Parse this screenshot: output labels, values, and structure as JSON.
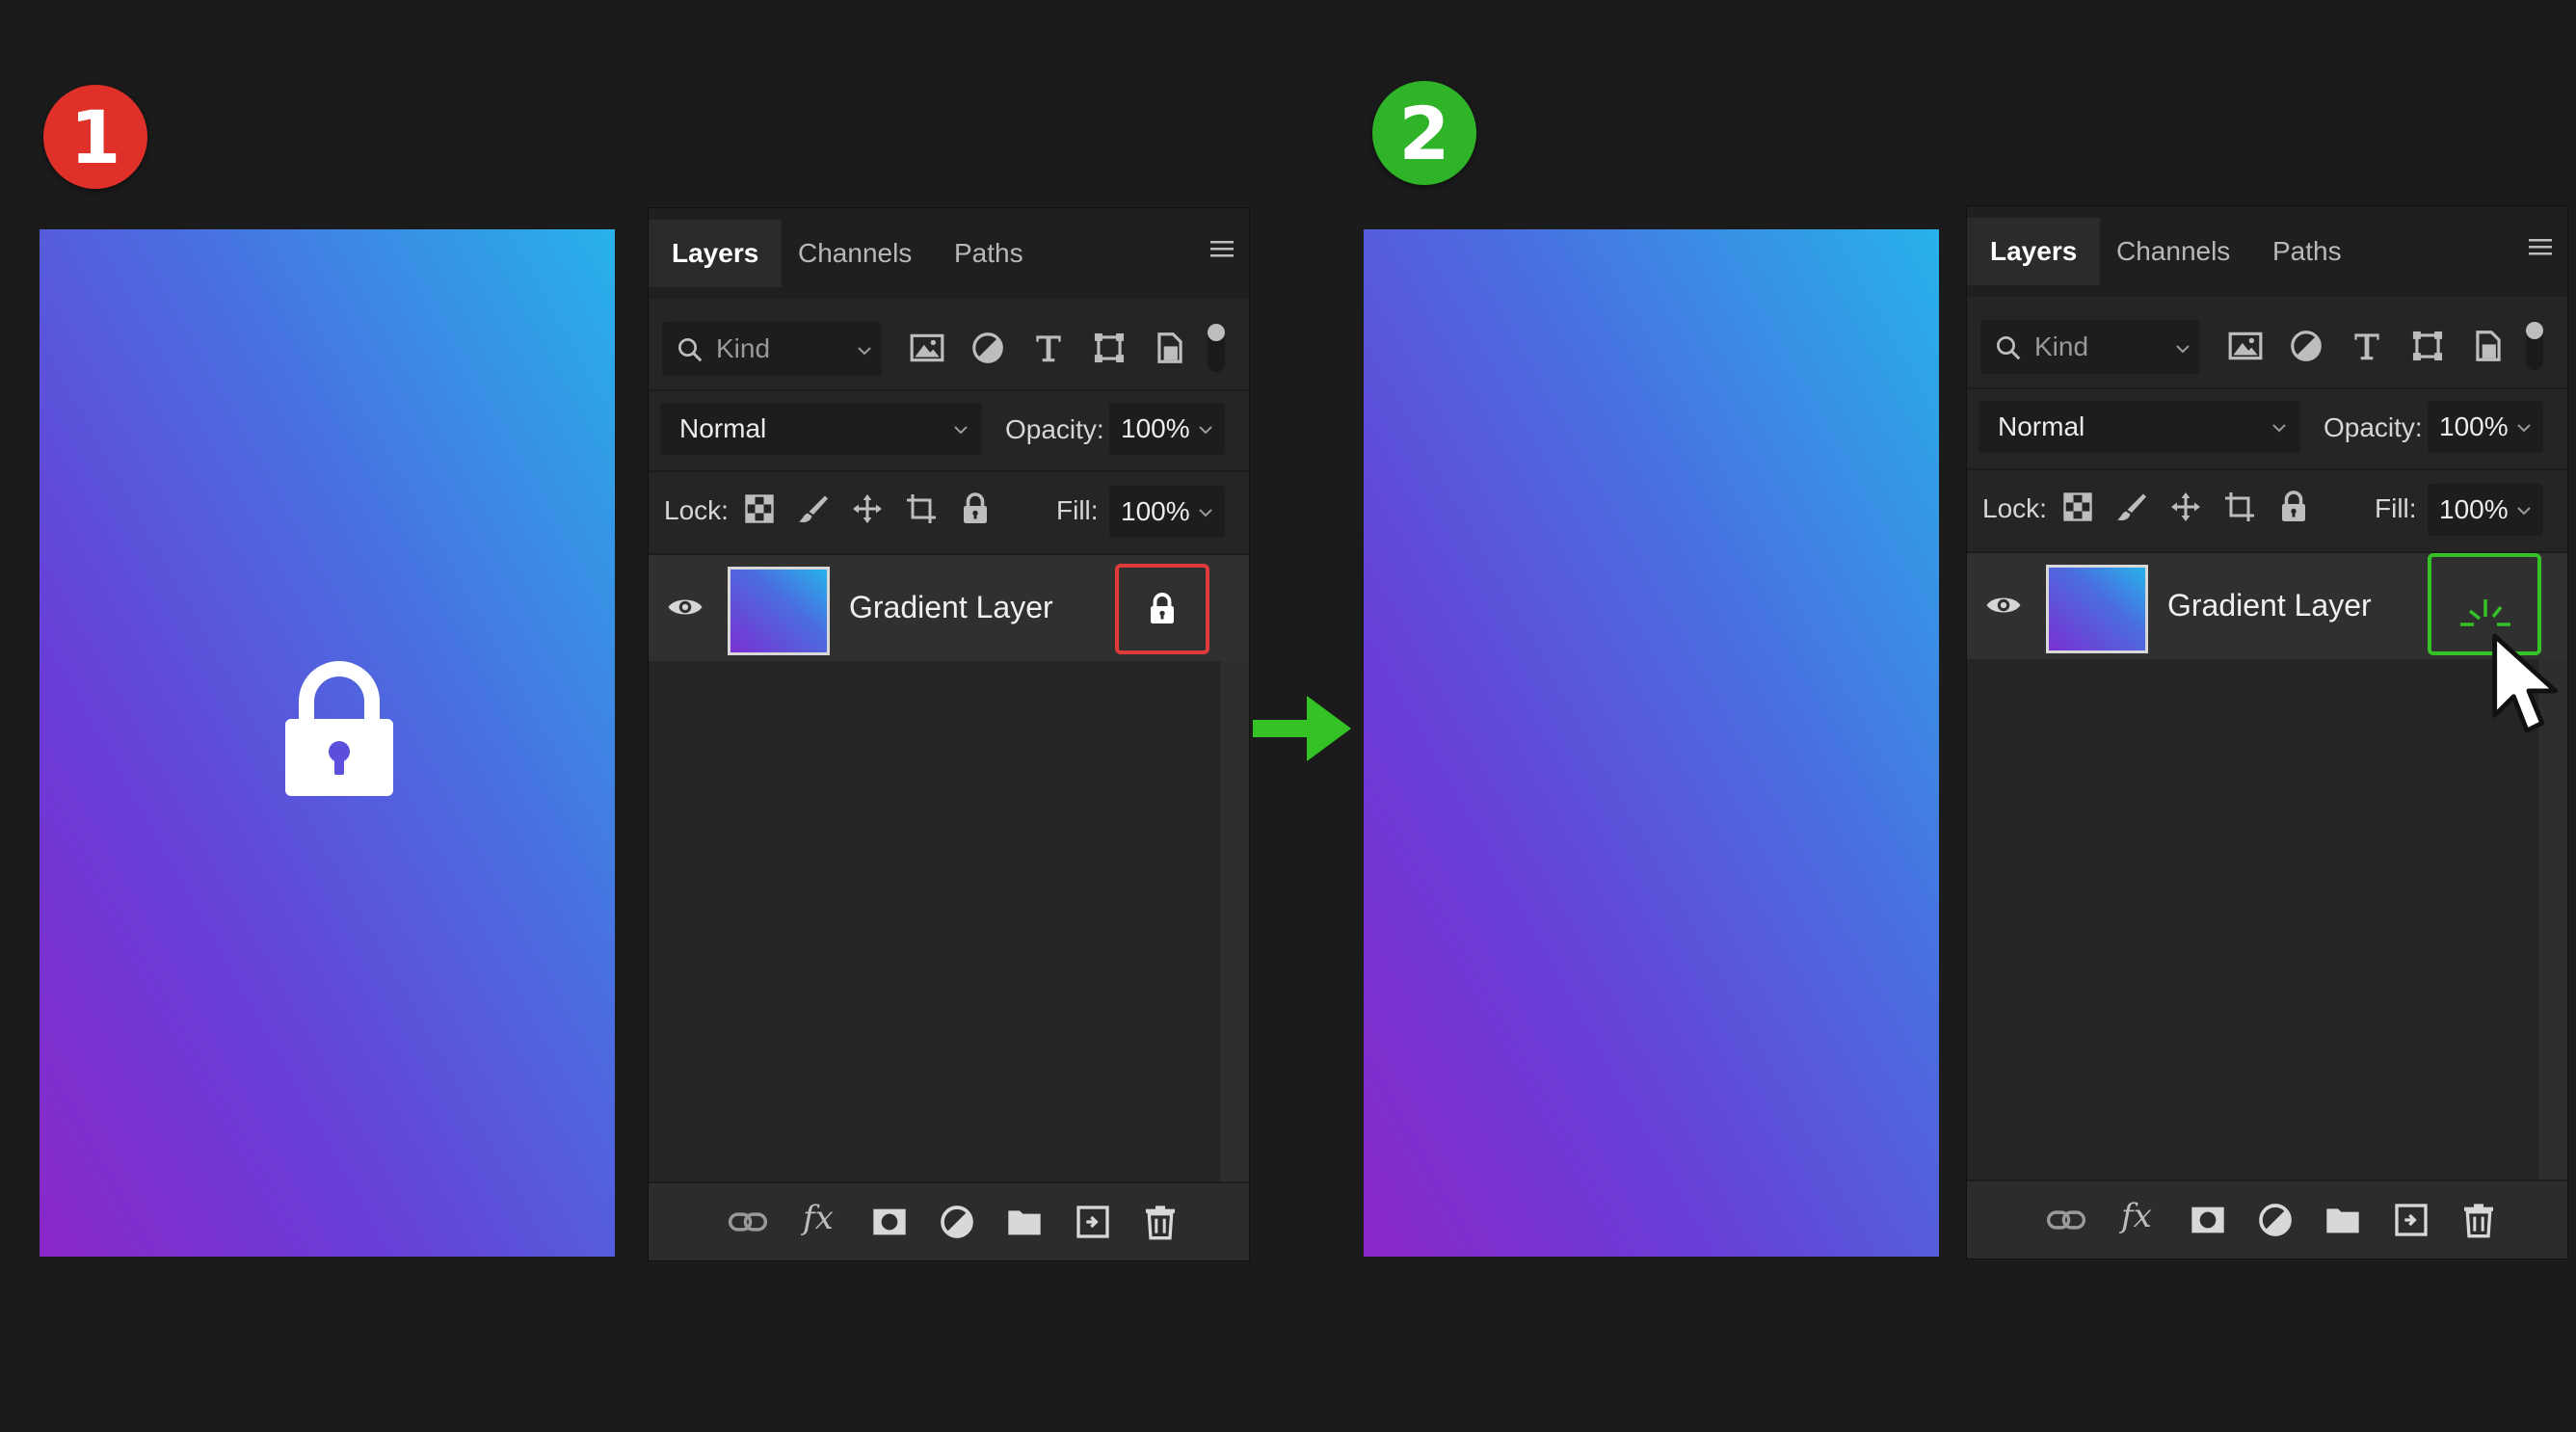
{
  "steps": [
    {
      "number": "1",
      "badge_color": "#e0302a"
    },
    {
      "number": "2",
      "badge_color": "#2fb329"
    }
  ],
  "panel": {
    "tabs": [
      "Layers",
      "Channels",
      "Paths"
    ],
    "active_tab": "Layers",
    "kind_placeholder": "Kind",
    "blend_mode": "Normal",
    "opacity_label": "Opacity:",
    "opacity_value": "100%",
    "lock_label": "Lock:",
    "fill_label": "Fill:",
    "fill_value": "100%",
    "layer_name": "Gradient Layer"
  },
  "colors": {
    "lock_highlight": "#e03a3a",
    "unlock_highlight": "#34c226",
    "arrow": "#34c226"
  },
  "icons": {
    "filter": [
      "image-filter-icon",
      "adjustment-filter-icon",
      "type-filter-icon",
      "shape-filter-icon",
      "smart-object-filter-icon"
    ],
    "lock": [
      "lock-transparent-pixels-icon",
      "lock-image-pixels-icon",
      "lock-position-icon",
      "lock-artboard-icon",
      "lock-all-icon"
    ],
    "footer": [
      "link-layers-icon",
      "fx-icon",
      "add-mask-icon",
      "new-adjustment-icon",
      "new-group-icon",
      "new-layer-icon",
      "delete-layer-icon"
    ]
  }
}
